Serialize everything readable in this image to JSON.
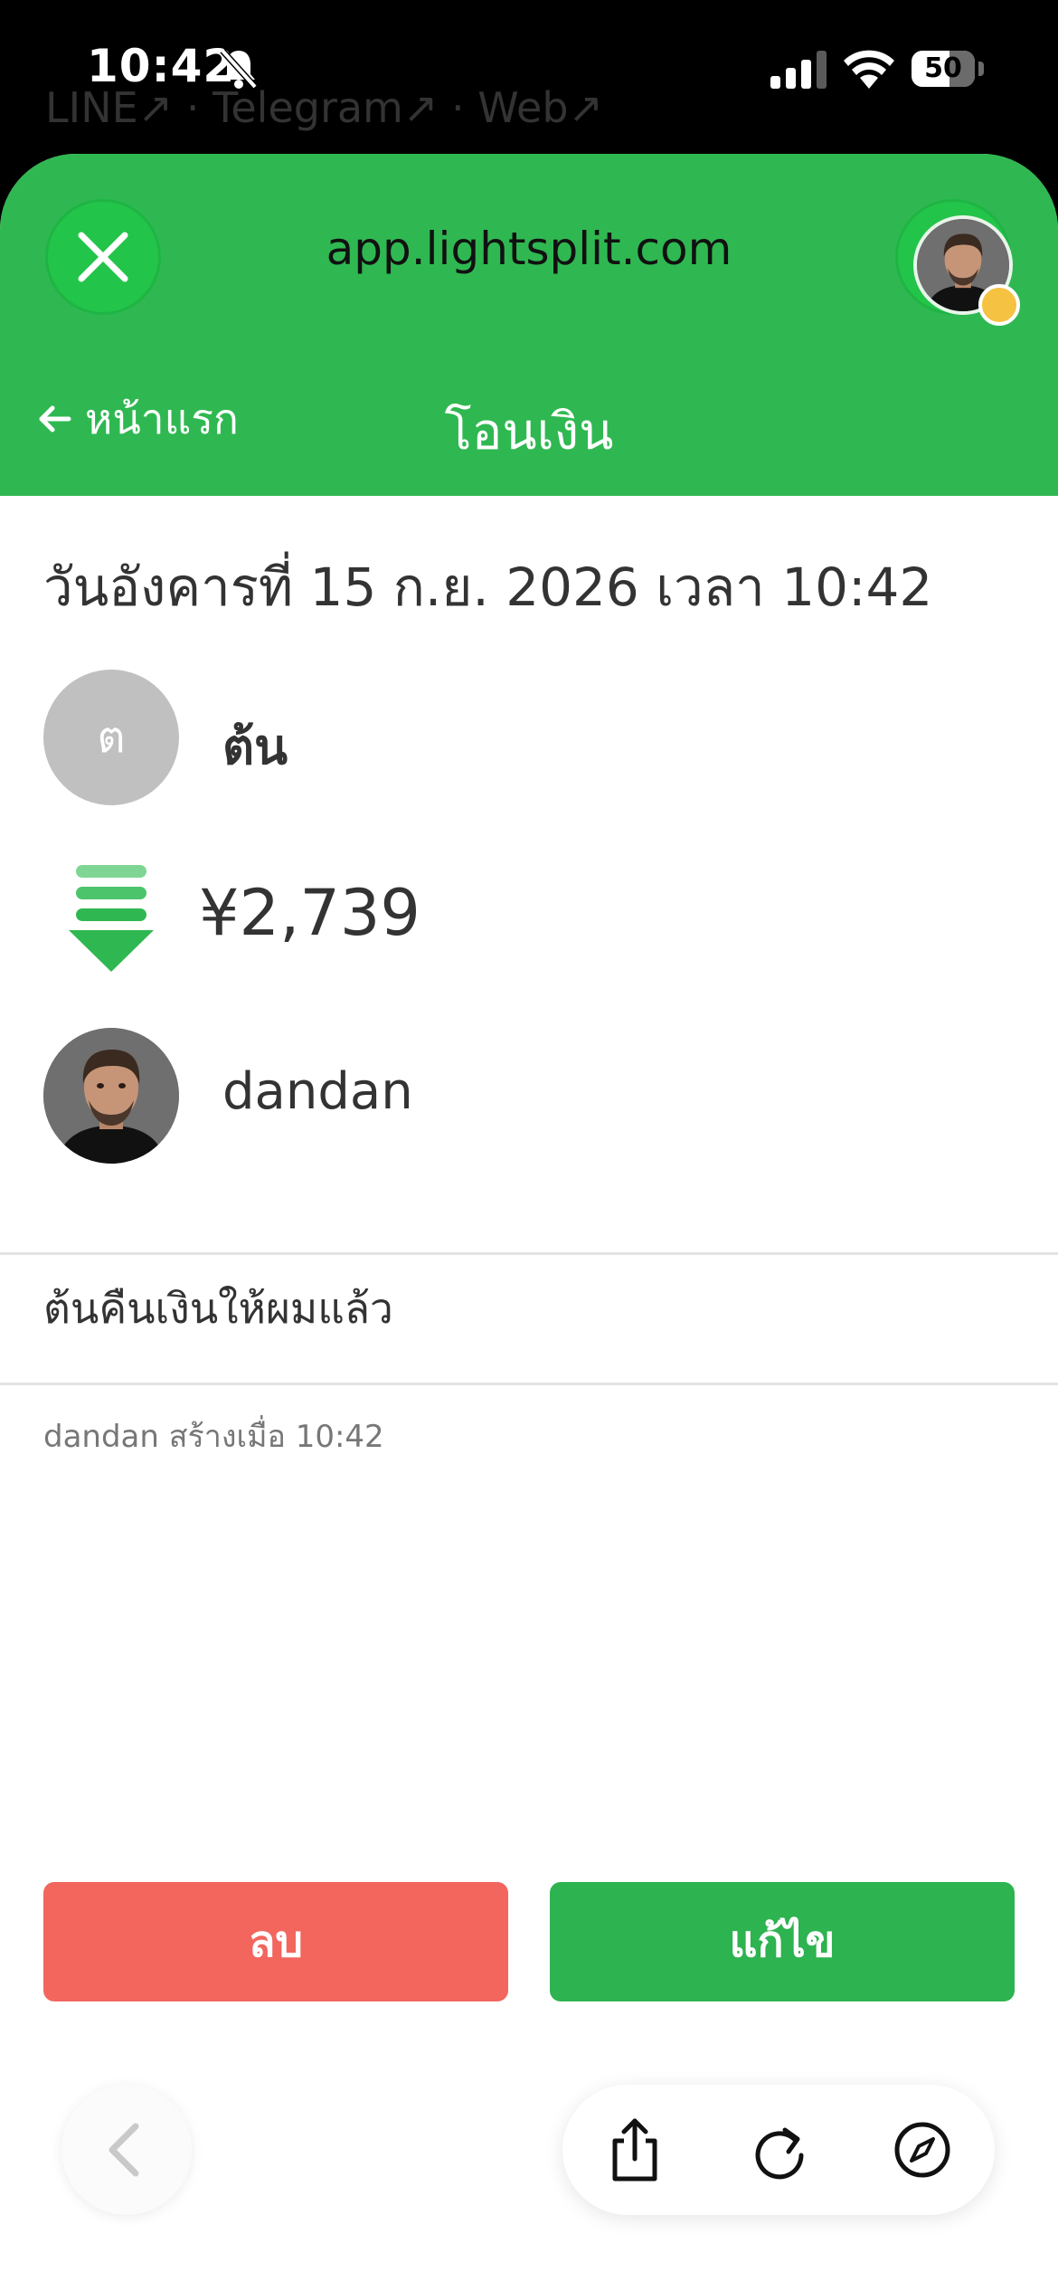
{
  "status_bar": {
    "time": "10:42",
    "battery": "50"
  },
  "background_links": "LINE↗ · Telegram↗ · Web↗",
  "browser": {
    "url": "app.lightsplit.com"
  },
  "header": {
    "back_label": "หน้าแรก",
    "title": "โอนเงิน"
  },
  "transfer": {
    "date": "วันอังคารที่ 15 ก.ย. 2026 เวลา 10:42",
    "from": {
      "initial": "ต",
      "name": "ต้น"
    },
    "amount": "¥2,739",
    "to": {
      "name": "dandan"
    },
    "note": "ต้นคืนเงินให้ผมแล้ว",
    "meta": "dandan สร้างเมื่อ 10:42"
  },
  "actions": {
    "delete_label": "ลบ",
    "edit_label": "แก้ไข"
  },
  "colors": {
    "brand_green": "#2fb851",
    "delete_red": "#f2665e",
    "edit_green": "#2db34f"
  },
  "icons": [
    "bell-slash-icon",
    "signal-icon",
    "wifi-icon",
    "battery-icon",
    "close-icon",
    "tabs-icon",
    "arrow-left-icon",
    "transfer-down-icon",
    "chevron-left-icon",
    "share-icon",
    "reload-icon",
    "compass-icon"
  ]
}
